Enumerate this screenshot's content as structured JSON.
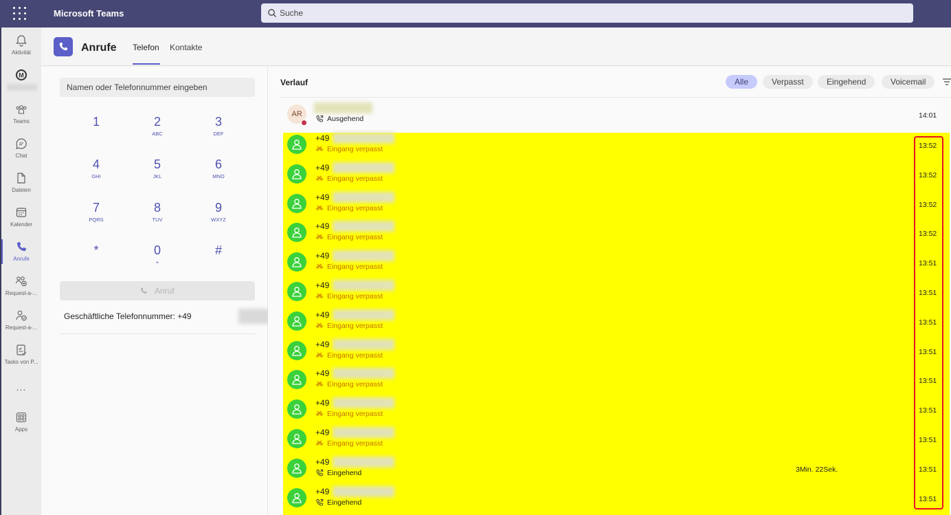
{
  "titlebar": {
    "app_name": "Microsoft Teams",
    "search_placeholder": "Suche"
  },
  "rail": {
    "items": [
      {
        "label": "Aktivität",
        "icon": "bell-icon"
      },
      {
        "label": "",
        "icon": "app-logo-icon"
      },
      {
        "label": "Teams",
        "icon": "teams-icon"
      },
      {
        "label": "Chat",
        "icon": "chat-icon"
      },
      {
        "label": "Dateien",
        "icon": "file-icon"
      },
      {
        "label": "Kalender",
        "icon": "calendar-icon"
      },
      {
        "label": "Anrufe",
        "icon": "phone-icon",
        "active": true
      },
      {
        "label": "Request-a-...",
        "icon": "request-icon"
      },
      {
        "label": "Request-a-...",
        "icon": "request-icon"
      },
      {
        "label": "Tasks von P...",
        "icon": "tasks-icon"
      },
      {
        "label": "Apps",
        "icon": "apps-icon"
      }
    ],
    "more": "..."
  },
  "header": {
    "title": "Anrufe",
    "tabs": [
      "Telefon",
      "Kontakte"
    ]
  },
  "dialpad": {
    "input_placeholder": "Namen oder Telefonnummer eingeben",
    "keys": [
      {
        "digit": "1",
        "letters": ""
      },
      {
        "digit": "2",
        "letters": "ABC"
      },
      {
        "digit": "3",
        "letters": "DEF"
      },
      {
        "digit": "4",
        "letters": "GHI"
      },
      {
        "digit": "5",
        "letters": "JKL"
      },
      {
        "digit": "6",
        "letters": "MNO"
      },
      {
        "digit": "7",
        "letters": "PQRS"
      },
      {
        "digit": "8",
        "letters": "TUV"
      },
      {
        "digit": "9",
        "letters": "WXYZ"
      },
      {
        "digit": "*",
        "letters": ""
      },
      {
        "digit": "0",
        "letters": "+"
      },
      {
        "digit": "#",
        "letters": ""
      }
    ],
    "call_button": "Anruf",
    "business_number_label": "Geschäftliche Telefonnummer: +49"
  },
  "history": {
    "title": "Verlauf",
    "filters": [
      "Alle",
      "Verpasst",
      "Eingehend",
      "Voicemail"
    ],
    "active_filter": "Alle",
    "calls": [
      {
        "caller": "",
        "avatar": "AR",
        "status": "Ausgehend",
        "type": "outgoing",
        "time": "14:01",
        "duration": ""
      },
      {
        "caller": "+49",
        "status": "Eingang verpasst",
        "type": "missed",
        "time": "13:52",
        "duration": ""
      },
      {
        "caller": "+49",
        "status": "Eingang verpasst",
        "type": "missed",
        "time": "13:52",
        "duration": ""
      },
      {
        "caller": "+49",
        "status": "Eingang verpasst",
        "type": "missed",
        "time": "13:52",
        "duration": ""
      },
      {
        "caller": "+49",
        "status": "Eingang verpasst",
        "type": "missed",
        "time": "13:52",
        "duration": ""
      },
      {
        "caller": "+49",
        "status": "Eingang verpasst",
        "type": "missed",
        "time": "13:51",
        "duration": ""
      },
      {
        "caller": "+49",
        "status": "Eingang verpasst",
        "type": "missed",
        "time": "13:51",
        "duration": ""
      },
      {
        "caller": "+49",
        "status": "Eingang verpasst",
        "type": "missed",
        "time": "13:51",
        "duration": ""
      },
      {
        "caller": "+49",
        "status": "Eingang verpasst",
        "type": "missed",
        "time": "13:51",
        "duration": ""
      },
      {
        "caller": "+49",
        "status": "Eingang verpasst",
        "type": "missed",
        "time": "13:51",
        "duration": ""
      },
      {
        "caller": "+49",
        "status": "Eingang verpasst",
        "type": "missed",
        "time": "13:51",
        "duration": ""
      },
      {
        "caller": "+49",
        "status": "Eingang verpasst",
        "type": "missed",
        "time": "13:51",
        "duration": ""
      },
      {
        "caller": "+49",
        "status": "Eingehend",
        "type": "incoming",
        "time": "13:51",
        "duration": "3Min. 22Sek."
      },
      {
        "caller": "+49",
        "status": "Eingehend",
        "type": "incoming",
        "time": "13:51",
        "duration": ""
      }
    ]
  },
  "colors": {
    "brand": "#5b5fc7",
    "titlebar": "#464775",
    "highlight": "#ffff00",
    "missed": "#c7700c",
    "annotation": "#e81123"
  }
}
